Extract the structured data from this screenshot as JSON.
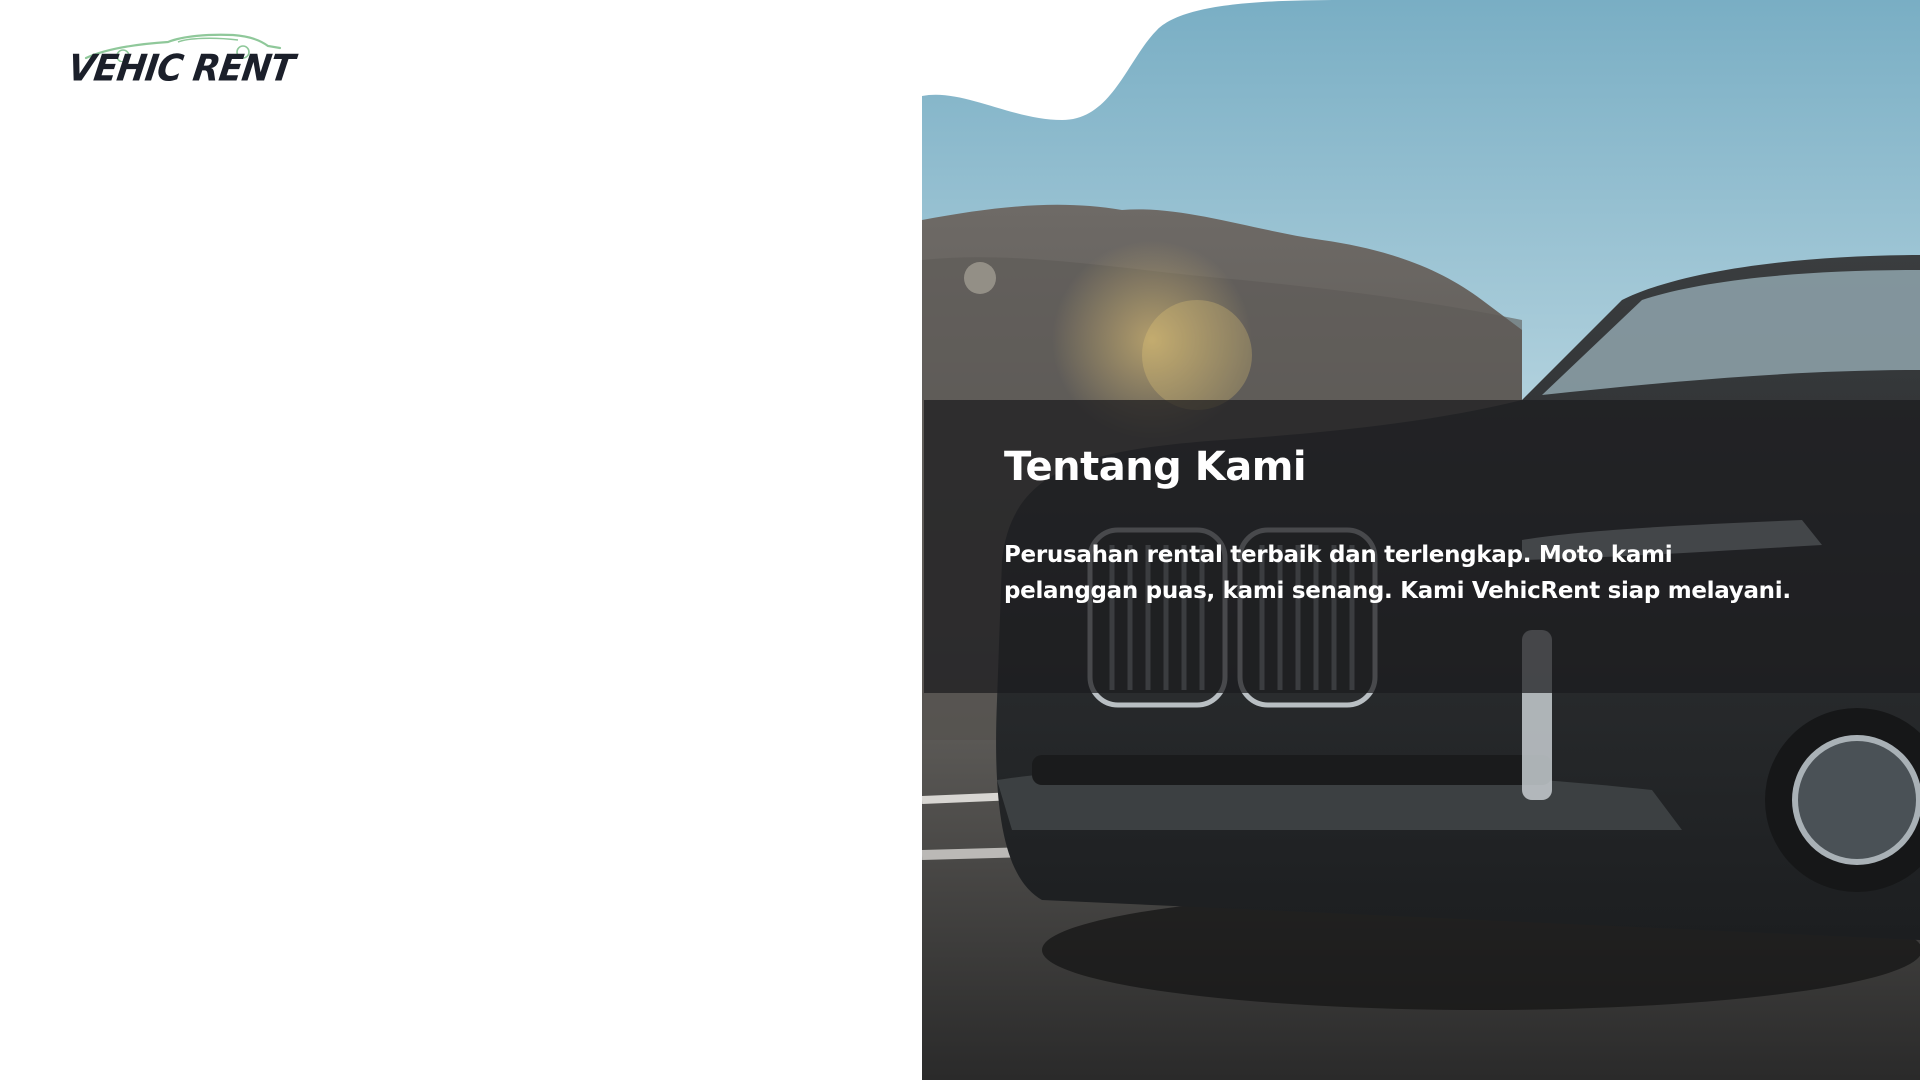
{
  "brand": {
    "logo_text": "VEHIC RENT",
    "accent_color": "#8fc89a",
    "text_color": "#1b1f2a"
  },
  "about": {
    "title": "Tentang Kami",
    "description": "Perusahan rental terbaik dan terlengkap. Moto kami pelanggan puas, kami senang. Kami VehicRent siap melayani."
  },
  "hero": {
    "image_subject": "dark suv car front on road with mountain and sky background",
    "overlay_color": "#1c1c1e"
  }
}
